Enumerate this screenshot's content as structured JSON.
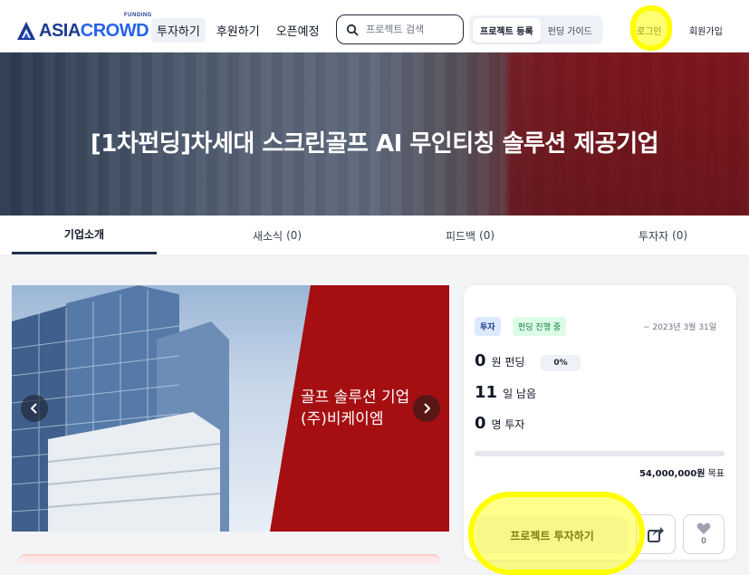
{
  "header": {
    "logo": {
      "brand_left": "ASIA",
      "brand_right": "CROWD",
      "sub": "FUNDING"
    },
    "nav": [
      {
        "label": "투자하기",
        "active": true
      },
      {
        "label": "후원하기",
        "active": false
      },
      {
        "label": "오픈예정",
        "active": false
      }
    ],
    "search": {
      "placeholder": "프로젝트 검색",
      "icon": "search-icon"
    },
    "register_project": "프로젝트 등록",
    "funding_guide": "펀딩 가이드",
    "login": "로그인",
    "signup": "회원가입"
  },
  "hero": {
    "title": "[1차펀딩]차세대 스크린골프 AI 무인티칭 솔루션 제공기업"
  },
  "tabs": [
    {
      "label": "기업소개",
      "count": "",
      "active": true
    },
    {
      "label": "새소식",
      "count": "(0)",
      "active": false
    },
    {
      "label": "피드백",
      "count": "(0)",
      "active": false
    },
    {
      "label": "투자자",
      "count": "(0)",
      "active": false
    }
  ],
  "carousel": {
    "slide_text_line1": "골프 솔루션 기업",
    "slide_text_line2": "(주)비케이엠"
  },
  "summary": {
    "badge_type": "투자",
    "badge_status": "펀딩 진행 중",
    "deadline": "~ 2023년 3월 31일",
    "amount_value": "0",
    "amount_unit": "원 펀딩",
    "percent": "0%",
    "progress_fraction": 0,
    "days_value": "11",
    "days_unit": "일 남음",
    "investors_value": "0",
    "investors_unit": "명 투자",
    "target_amount": "54,000,000원",
    "target_label": "목표",
    "invest_button": "프로젝트 투자하기",
    "likes": "0"
  },
  "colors": {
    "brand_navy": "#1f3a93",
    "brand_blue": "#2563eb",
    "hero_red": "#a50f12",
    "highlight": "#ffff00"
  }
}
